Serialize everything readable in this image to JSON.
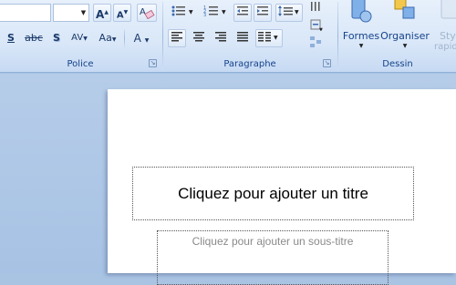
{
  "ribbon": {
    "groups": {
      "police": "Police",
      "paragraphe": "Paragraphe",
      "dessin": "Dessin"
    },
    "police": {
      "font_name_value": "",
      "font_size_value": "",
      "grow_font_icon": "A↑",
      "shrink_font_icon": "A↓",
      "clear_format_icon": "clear-formatting-icon",
      "strike_label": "abc",
      "shadow_label": "S",
      "underline_s_label": "S",
      "spacing_label": "AV",
      "case_label": "Aa",
      "color_label": "A"
    },
    "dessin": {
      "formes_label": "Formes",
      "organiser_label": "Organiser",
      "styles_label_1": "Styl",
      "styles_label_2": "rapid"
    }
  },
  "slide": {
    "title_placeholder": "Cliquez pour ajouter un titre",
    "subtitle_placeholder": "Cliquez pour ajouter un sous-titre"
  }
}
